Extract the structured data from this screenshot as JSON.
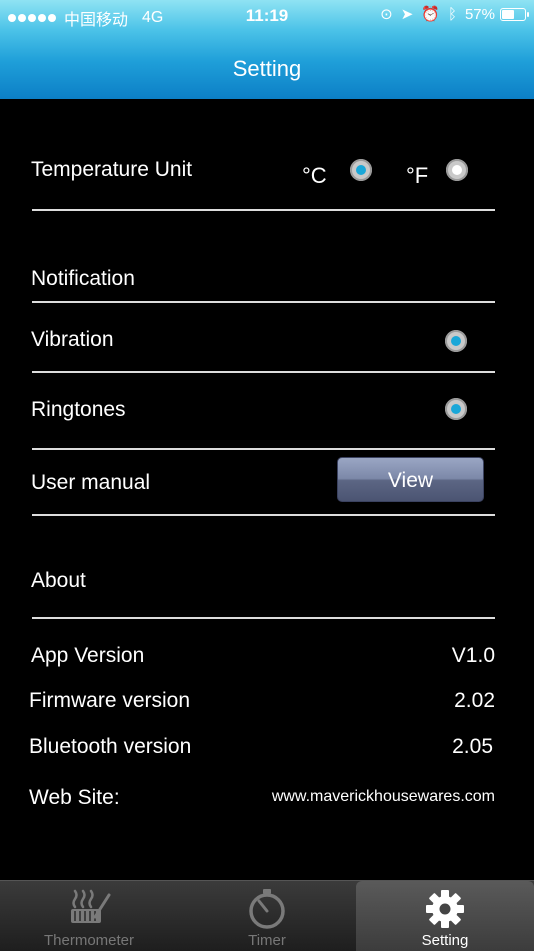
{
  "status_bar": {
    "carrier": "中国移动",
    "network": "4G",
    "time": "11:19",
    "battery_percent": "57%",
    "battery_level": 0.57
  },
  "header": {
    "title": "Setting"
  },
  "temperature": {
    "label": "Temperature Unit",
    "celsius_label": "°C",
    "fahrenheit_label": "°F",
    "selected": "celsius"
  },
  "notification": {
    "heading": "Notification",
    "vibration_label": "Vibration",
    "vibration_on": true,
    "ringtones_label": "Ringtones",
    "ringtones_on": true
  },
  "user_manual": {
    "label": "User manual",
    "button_label": "View"
  },
  "about": {
    "heading": "About",
    "app_version_label": "App Version",
    "app_version_value": "V1.0",
    "firmware_label": "Firmware version",
    "firmware_value": "2.02",
    "bluetooth_label": "Bluetooth version",
    "bluetooth_value": "2.05",
    "website_label": "Web Site:",
    "website_value": "www.maverickhousewares.com"
  },
  "tabs": [
    {
      "label": "Thermometer",
      "icon": "grill-icon",
      "active": false
    },
    {
      "label": "Timer",
      "icon": "timer-icon",
      "active": false
    },
    {
      "label": "Setting",
      "icon": "gear-icon",
      "active": true
    }
  ],
  "colors": {
    "accent": "#1aa7d8",
    "header_top": "#8fe3f3",
    "header_bottom": "#0c7fc6",
    "background": "#000000"
  }
}
